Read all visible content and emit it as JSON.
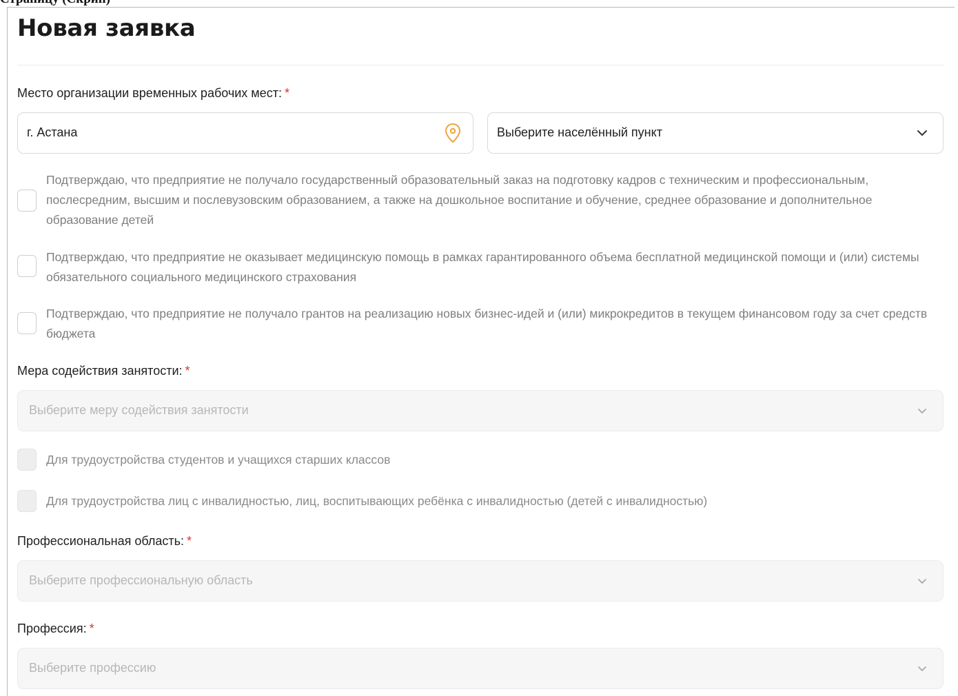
{
  "header": {
    "cut_title": "Страницу (Скрин)"
  },
  "form": {
    "title": "Новая заявка",
    "location": {
      "label": "Место организации временных рабочих мест:",
      "required": "*",
      "city_value": "г. Астана",
      "settlement_placeholder": "Выберите населённый пункт"
    },
    "confirmations": [
      {
        "text": "Подтверждаю, что предприятие не получало государственный образовательный заказ на подготовку кадров с техническим и профессиональным, послесредним, высшим и послевузовским образованием, а также на дошкольное воспитание и обучение, среднее образование и дополнительное образование детей"
      },
      {
        "text": "Подтверждаю, что предприятие не оказывает медицинскую помощь в рамках гарантированного объема бесплатной медицинской помощи и (или) системы обязательного социального медицинского страхования"
      },
      {
        "text": "Подтверждаю, что предприятие не получало грантов на реализацию новых бизнес-идей и (или) микрокредитов в текущем финансовом году за счет средств бюджета"
      }
    ],
    "employment_measure": {
      "label": "Мера содействия занятости:",
      "required": "*",
      "placeholder": "Выберите меру содействия занятости"
    },
    "options": [
      {
        "text": "Для трудоустройства студентов и учащихся старших классов"
      },
      {
        "text": "Для трудоустройства лиц с инвалидностью, лиц, воспитывающих ребёнка с инвалидностью (детей с инвалидностью)"
      }
    ],
    "professional_area": {
      "label": "Профессиональная область:",
      "required": "*",
      "placeholder": "Выберите профессиональную область"
    },
    "profession": {
      "label": "Профессия:",
      "required": "*",
      "placeholder": "Выберите профессию"
    }
  },
  "icons": {
    "location": "location-pin-icon",
    "dropdown": "chevron-down-icon"
  },
  "colors": {
    "required": "#e03131",
    "pin": "#f2a33a",
    "border": "#d9d9d9",
    "disabled_bg": "#f6f6f6"
  }
}
